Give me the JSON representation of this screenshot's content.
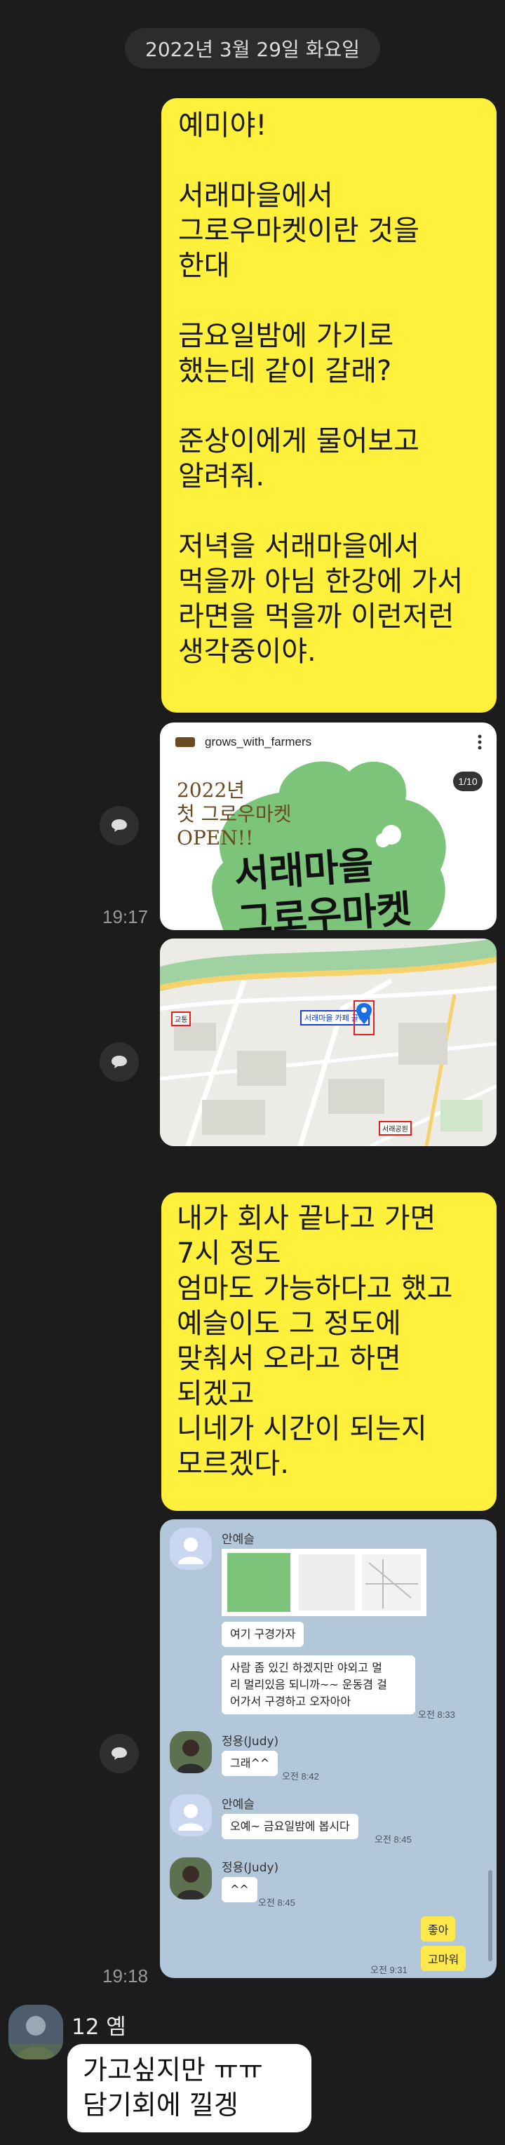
{
  "date_divider": "2022년 3월 29일 화요일",
  "messages": {
    "m1": "예미야!\n\n서래마을에서\n그로우마켓이란 것을\n한대\n\n금요일밤에 가기로\n했는데 같이 갈래?\n\n준상이에게 물어보고\n알려줘.\n\n저녁을 서래마을에서\n먹을까 아님 한강에 가서\n라면을 먹을까 이런저런\n생각중이야.",
    "m2": "내가 회사 끝나고 가면\n7시 정도\n엄마도 가능하다고 했고\n예슬이도 그 정도에\n맞춰서 오라고 하면\n되겠고\n니네가 시간이 되는지\n모르겠다.",
    "reply": "가고싶지만 ㅠㅠ\n담기회에 낄겡"
  },
  "times": {
    "t1": "19:17",
    "t2": "19:18"
  },
  "instagram_card": {
    "handle": "grows_with_farmers",
    "counter": "1/10",
    "headline": "2022년\n첫 그로우마켓\nOPEN!!",
    "cursive": "서래마을\n그로우마켓"
  },
  "map_card": {
    "blue_label": "서래마을 카페 골목",
    "left_label": "교통",
    "bottom_label": "서래공원"
  },
  "chat_screenshot": {
    "sender_1": "안예슬",
    "msg_1": "여기 구경가자",
    "msg_2": "사람 좀 있긴 하겠지만 야외고 멀\n리 멀리있음 되니까~~ 운동겸 걸\n어가서 구경하고 오자아아",
    "time_1": "오전 8:33",
    "sender_2": "정용(Judy)",
    "msg_3": "그래^^",
    "time_2": "오전 8:42",
    "sender_3": "안예슬",
    "msg_4": "오예~ 금요일밤에 봅시다",
    "time_3": "오전 8:45",
    "sender_4": "정용(Judy)",
    "msg_5": "^^",
    "time_4": "오전 8:45",
    "mine_1": "좋아",
    "mine_2": "고마워",
    "time_5": "오전 9:31"
  },
  "sender": {
    "name": "12 옘"
  },
  "colors": {
    "bg": "#1c1c1c",
    "my_bubble": "#fff03c",
    "their_bubble": "#ffffff",
    "chat_bg": "#b2c7da"
  },
  "icons": {
    "share": "share-icon",
    "pin": "map-pin-icon",
    "more": "more-icon"
  }
}
